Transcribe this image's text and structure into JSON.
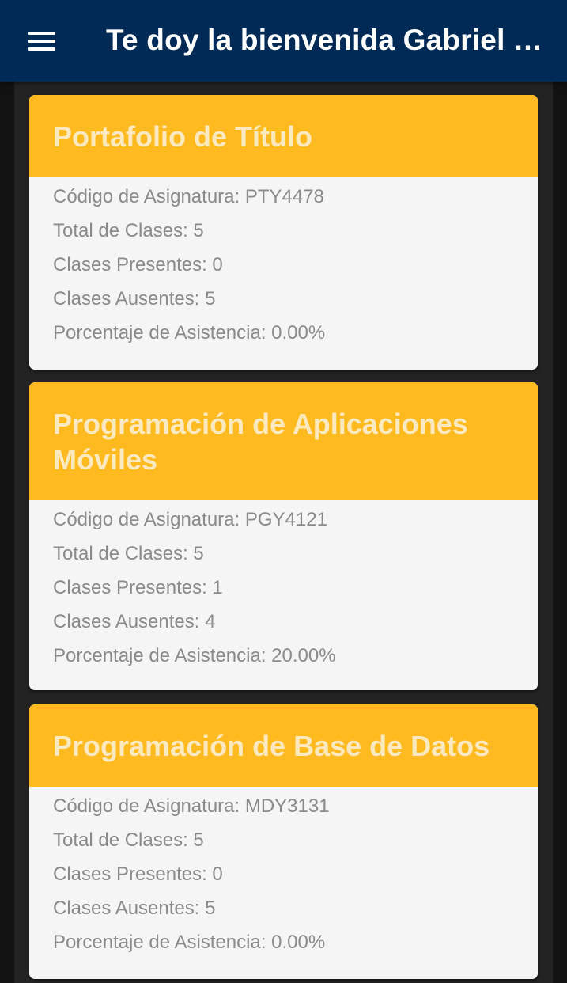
{
  "header": {
    "title": "Te doy la bienvenida Gabriel O...",
    "menu_icon": "menu-icon"
  },
  "colors": {
    "toolbar": "#012a56",
    "card_header": "#ffba20",
    "card_title": "#fbe9c0",
    "card_body": "#f5f5f5",
    "body_text": "#8a8a8a",
    "background": "#232323"
  },
  "courses": [
    {
      "title": "Portafolio de Título",
      "code": "Código de Asignatura: PTY4478",
      "total": "Total de Clases: 5",
      "present": "Clases Presentes: 0",
      "absent": "Clases Ausentes: 5",
      "percentage": "Porcentaje de Asistencia: 0.00%"
    },
    {
      "title": "Programación de Aplicaciones Móviles",
      "code": "Código de Asignatura: PGY4121",
      "total": "Total de Clases: 5",
      "present": "Clases Presentes: 1",
      "absent": "Clases Ausentes: 4",
      "percentage": "Porcentaje de Asistencia: 20.00%"
    },
    {
      "title": "Programación de Base de Datos",
      "code": "Código de Asignatura: MDY3131",
      "total": "Total de Clases: 5",
      "present": "Clases Presentes: 0",
      "absent": "Clases Ausentes: 5",
      "percentage": "Porcentaje de Asistencia: 0.00%"
    }
  ]
}
